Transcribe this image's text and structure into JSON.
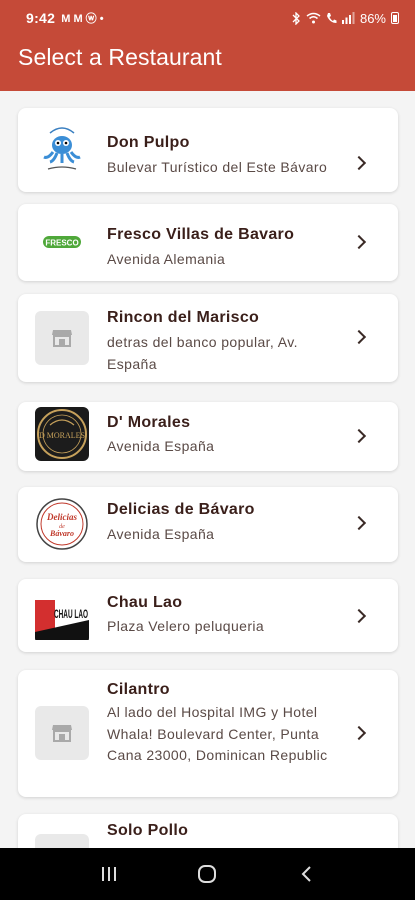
{
  "status": {
    "time": "9:42",
    "left_icons": "M M ⓦ •",
    "battery": "86%"
  },
  "header": {
    "title": "Select a Restaurant"
  },
  "restaurants": [
    {
      "name": "Don Pulpo",
      "address": "Bulevar Turístico del Este Bávaro",
      "logo": "octopus-logo"
    },
    {
      "name": "Fresco Villas de Bavaro",
      "address": "Avenida Alemania",
      "logo": "fresco-logo"
    },
    {
      "name": "Rincon del Marisco",
      "address": "detras del banco popular, Av. España",
      "logo": "store-placeholder-icon"
    },
    {
      "name": "D' Morales",
      "address": "Avenida España",
      "logo": "d-morales-logo"
    },
    {
      "name": "Delicias de Bávaro",
      "address": "Avenida España",
      "logo": "delicias-logo"
    },
    {
      "name": "Chau Lao",
      "address": "Plaza Velero peluqueria",
      "logo": "chau-lao-logo"
    },
    {
      "name": "Cilantro",
      "address": "Al lado del Hospital IMG y Hotel Whala! Boulevard Center, Punta Cana 23000, Dominican Republic",
      "logo": "store-placeholder-icon"
    },
    {
      "name": "Solo Pollo",
      "address": "",
      "logo": "store-placeholder-icon"
    }
  ],
  "logo_text": {
    "fresco": "FRESCO",
    "dmorales": "D MORALES",
    "delicias_top": "Delicias",
    "delicias_mid": "de",
    "delicias_bottom": "Bávaro",
    "chaulao": "CHAU LAO"
  },
  "colors": {
    "header": "#c54a38",
    "name_text": "#3a1f1a"
  }
}
